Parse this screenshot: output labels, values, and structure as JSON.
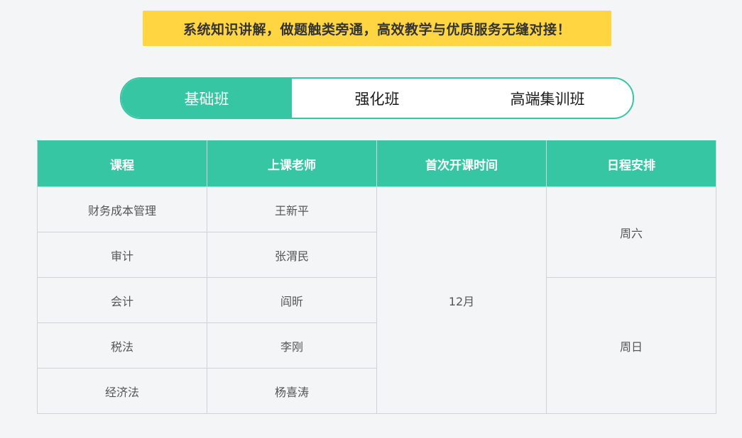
{
  "banner": {
    "text": "系统知识讲解，做题触类旁通，高效教学与优质服务无缝对接！"
  },
  "tabs": [
    {
      "label": "基础班",
      "active": true
    },
    {
      "label": "强化班",
      "active": false
    },
    {
      "label": "高端集训班",
      "active": false
    }
  ],
  "table": {
    "headers": [
      "课程",
      "上课老师",
      "首次开课时间",
      "日程安排"
    ],
    "rows": [
      {
        "course": "财务成本管理",
        "teacher": "王新平"
      },
      {
        "course": "审计",
        "teacher": "张渭民"
      },
      {
        "course": "会计",
        "teacher": "阎昕"
      },
      {
        "course": "税法",
        "teacher": "李刚"
      },
      {
        "course": "经济法",
        "teacher": "杨喜涛"
      }
    ],
    "first_class_time": "12月",
    "schedule": [
      "周六",
      "周日"
    ]
  },
  "colors": {
    "accent": "#37c6a3",
    "banner_bg": "#ffd541",
    "page_bg": "#f4f5f7",
    "border": "#cfd3d6"
  }
}
